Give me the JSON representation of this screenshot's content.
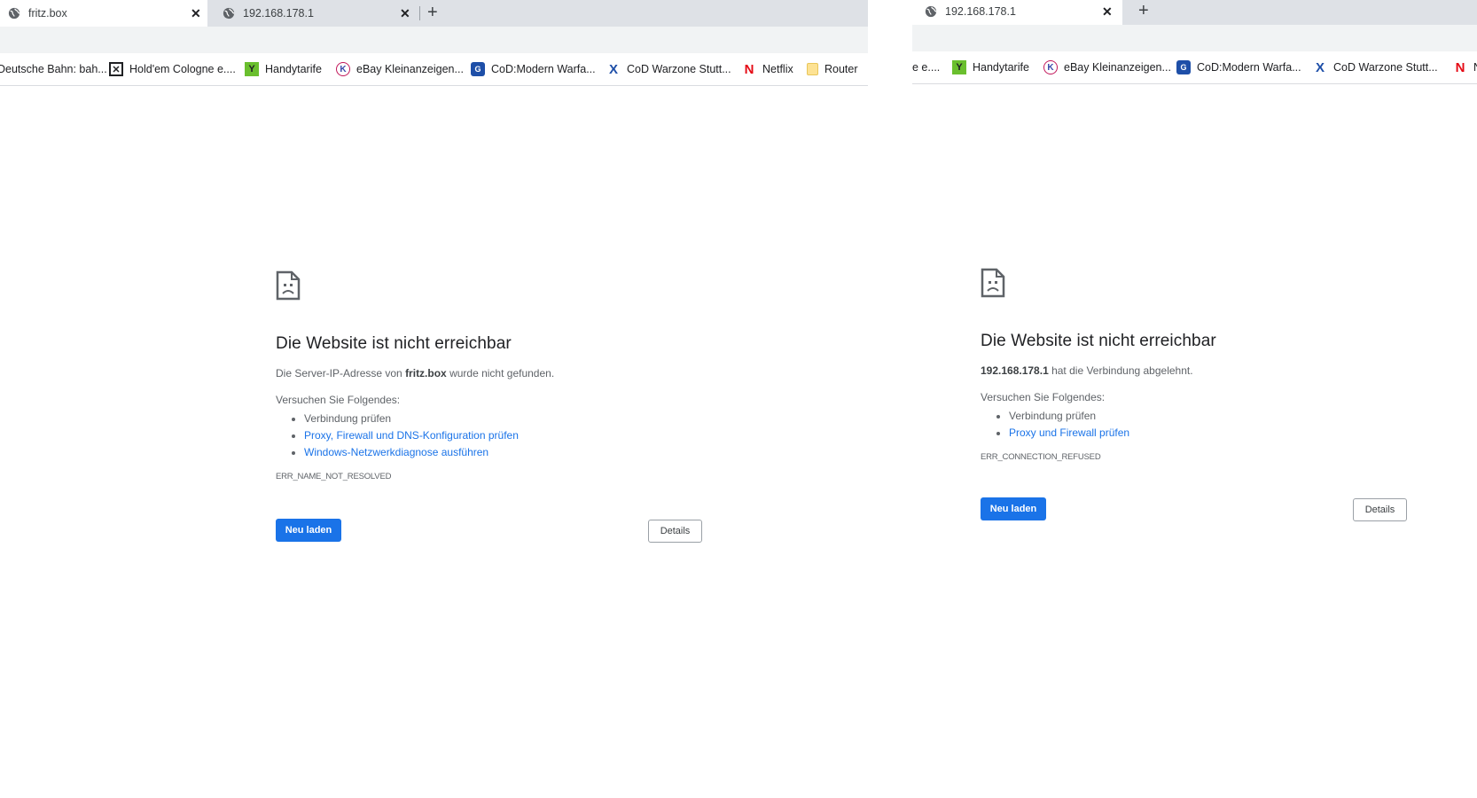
{
  "left": {
    "tabs": [
      {
        "title": "fritz.box",
        "active": true
      },
      {
        "title": "192.168.178.1",
        "active": false
      }
    ],
    "bookmarks": [
      {
        "label": "Deutsche Bahn: bah...",
        "icon": "db-icon"
      },
      {
        "label": "Hold'em Cologne e....",
        "icon": "holdem-icon"
      },
      {
        "label": "Handytarife",
        "icon": "handytarife-icon"
      },
      {
        "label": "eBay Kleinanzeigen...",
        "icon": "ebay-kleinanzeigen-icon"
      },
      {
        "label": "CoD:Modern Warfa...",
        "icon": "cod-icon"
      },
      {
        "label": "CoD Warzone Stutt...",
        "icon": "warzone-icon"
      },
      {
        "label": "Netflix",
        "icon": "netflix-icon"
      },
      {
        "label": "Router",
        "icon": "folder-icon"
      }
    ],
    "error": {
      "title": "Die Website ist nicht erreichbar",
      "msg_pre": "Die Server-IP-Adresse von ",
      "msg_bold": "fritz.box",
      "msg_post": " wurde nicht gefunden.",
      "try_label": "Versuchen Sie Folgendes:",
      "suggestions": [
        {
          "text": "Verbindung prüfen",
          "link": false
        },
        {
          "text": "Proxy, Firewall und DNS-Konfiguration prüfen",
          "link": true
        },
        {
          "text": "Windows-Netzwerkdiagnose ausführen",
          "link": true
        }
      ],
      "code": "ERR_NAME_NOT_RESOLVED",
      "reload_label": "Neu laden",
      "details_label": "Details"
    }
  },
  "right": {
    "tabs": [
      {
        "title": "192.168.178.1",
        "active": true
      }
    ],
    "bookmarks": [
      {
        "label": "e e....",
        "icon": "holdem-icon"
      },
      {
        "label": "Handytarife",
        "icon": "handytarife-icon"
      },
      {
        "label": "eBay Kleinanzeigen...",
        "icon": "ebay-kleinanzeigen-icon"
      },
      {
        "label": "CoD:Modern Warfa...",
        "icon": "cod-icon"
      },
      {
        "label": "CoD Warzone Stutt...",
        "icon": "warzone-icon"
      },
      {
        "label": "N",
        "icon": "netflix-icon"
      }
    ],
    "error": {
      "title": "Die Website ist nicht erreichbar",
      "msg_bold": "192.168.178.1",
      "msg_post": " hat die Verbindung abgelehnt.",
      "try_label": "Versuchen Sie Folgendes:",
      "suggestions": [
        {
          "text": "Verbindung prüfen",
          "link": false
        },
        {
          "text": "Proxy und Firewall prüfen",
          "link": true
        }
      ],
      "code": "ERR_CONNECTION_REFUSED",
      "reload_label": "Neu laden",
      "details_label": "Details"
    }
  },
  "colors": {
    "accent": "#1a73e8",
    "tabstrip": "#dee1e6",
    "toolbar": "#f1f3f4",
    "netflix": "#e50914"
  }
}
